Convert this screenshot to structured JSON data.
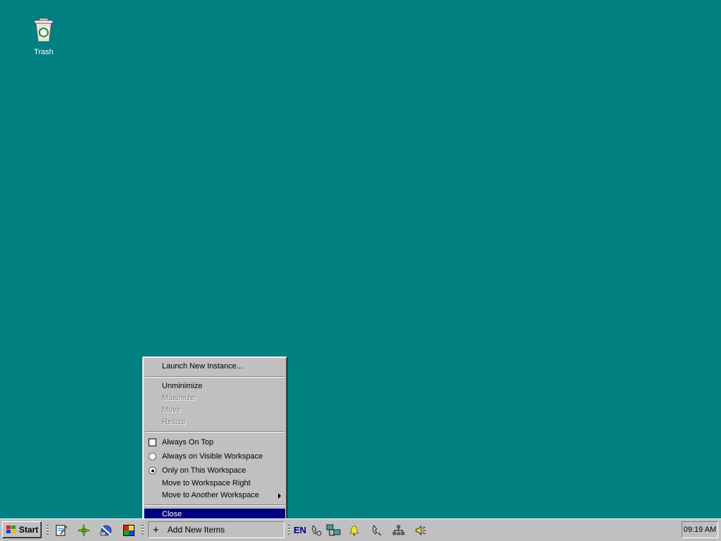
{
  "desktop": {
    "icons": [
      {
        "label": "Trash",
        "icon": "recycle-bin-icon"
      }
    ]
  },
  "context_menu": {
    "items": [
      {
        "label": "Launch New Instance...",
        "enabled": true
      },
      {
        "label": "Unminimize",
        "enabled": true
      },
      {
        "label": "Maximize",
        "enabled": false
      },
      {
        "label": "Move",
        "enabled": false
      },
      {
        "label": "Resize",
        "enabled": false
      },
      {
        "label": "Always On Top",
        "type": "checkbox",
        "checked": false
      },
      {
        "label": "Always on Visible Workspace",
        "type": "radio",
        "checked": false
      },
      {
        "label": "Only on This Workspace",
        "type": "radio",
        "checked": true
      },
      {
        "label": "Move to Workspace Right",
        "enabled": true
      },
      {
        "label": "Move to Another Workspace",
        "submenu": true
      },
      {
        "label": "Close",
        "selected": true
      }
    ]
  },
  "taskbar": {
    "start_label": "Start",
    "quick_launch": [
      "notepad-icon",
      "web-browser-icon",
      "network-tool-icon",
      "color-picker-icon"
    ],
    "add_items_label": "Add New Items",
    "language": "EN",
    "tray_icons": [
      "phone-settings-icon",
      "network-computers-icon",
      "bell-icon",
      "phone-icon",
      "network-tree-icon",
      "speaker-icon"
    ],
    "clock": "09:19 AM"
  },
  "colors": {
    "desktop": "#008080",
    "menu_bg": "#c0c0c0",
    "selection": "#000080"
  }
}
